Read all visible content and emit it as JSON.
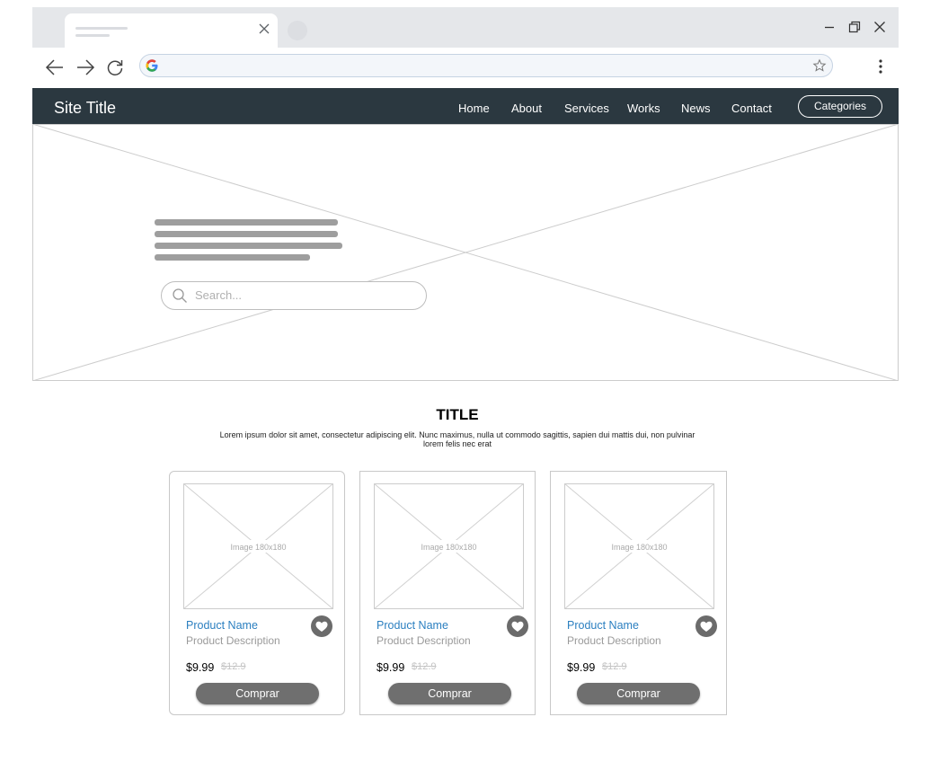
{
  "browser": {
    "tab_title": "",
    "address": ""
  },
  "site": {
    "title": "Site Title",
    "nav": [
      "Home",
      "About",
      "Services",
      "Works",
      "News",
      "Contact"
    ],
    "categories_label": "Categories"
  },
  "hero": {
    "search_placeholder": "Search..."
  },
  "section": {
    "title": "TITLE",
    "subtitle_line1": "Lorem ipsum dolor sit amet, consectetur adipiscing elit. Nunc maximus, nulla ut commodo sagittis, sapien dui mattis dui, non pulvinar",
    "subtitle_line2": "lorem felis nec erat"
  },
  "products": [
    {
      "image_label": "Image 180x180",
      "name": "Product Name",
      "description": "Product Description",
      "price": "$9.99",
      "old_price": "$12.9",
      "button": "Comprar"
    },
    {
      "image_label": "Image 180x180",
      "name": "Product Name",
      "description": "Product Description",
      "price": "$9.99",
      "old_price": "$12.9",
      "button": "Comprar"
    },
    {
      "image_label": "Image 180x180",
      "name": "Product Name",
      "description": "Product Description",
      "price": "$9.99",
      "old_price": "$12.9",
      "button": "Comprar"
    }
  ],
  "colors": {
    "nav_bg": "#2b3840",
    "accent_link": "#2b7fc0",
    "button_bg": "#6f6f6f"
  },
  "icons": [
    "back-arrow-icon",
    "forward-arrow-icon",
    "reload-icon",
    "google-icon",
    "star-icon",
    "kebab-menu-icon",
    "search-icon",
    "heart-icon",
    "close-icon",
    "minimize-icon",
    "restore-icon"
  ]
}
